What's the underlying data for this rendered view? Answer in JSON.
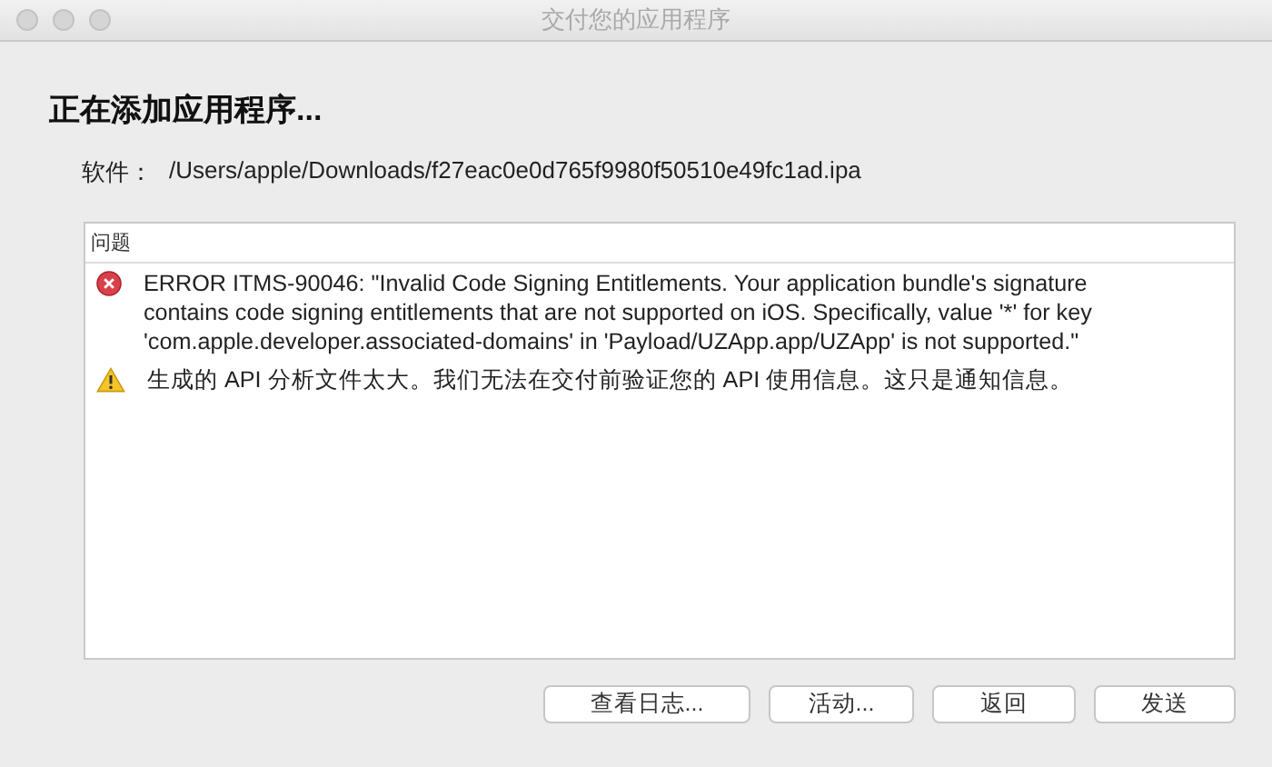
{
  "window": {
    "title": "交付您的应用程序"
  },
  "heading": "正在添加应用程序...",
  "software": {
    "label": "软件：",
    "path": "/Users/apple/Downloads/f27eac0e0d765f9980f50510e49fc1ad.ipa"
  },
  "issues": {
    "column": "问题",
    "rows": [
      {
        "kind": "error",
        "text": "ERROR ITMS-90046: \"Invalid Code Signing Entitlements. Your application bundle's signature contains code signing entitlements that are not supported on iOS. Specifically, value '*' for key 'com.apple.developer.associated-domains' in 'Payload/UZApp.app/UZApp' is not supported.\""
      },
      {
        "kind": "warning",
        "text": "生成的 API 分析文件太大。我们无法在交付前验证您的 API 使用信息。这只是通知信息。"
      }
    ]
  },
  "buttons": [
    "查看日志...",
    "活动...",
    "返回",
    "发送"
  ]
}
